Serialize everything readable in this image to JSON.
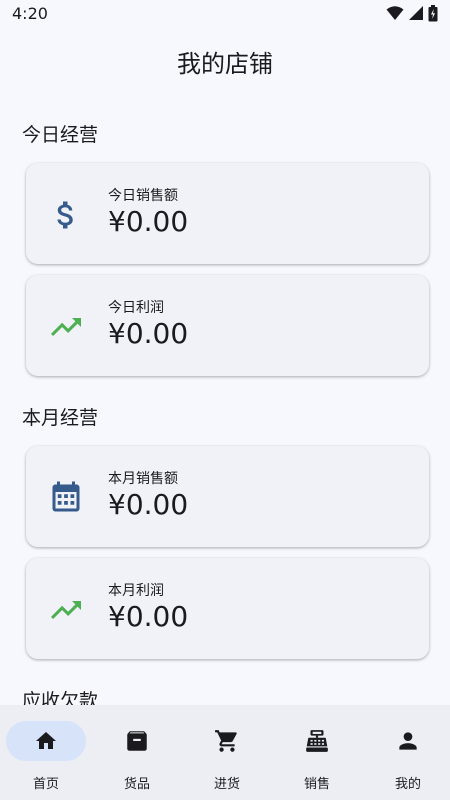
{
  "status_bar": {
    "time": "4:20"
  },
  "page": {
    "title": "我的店铺"
  },
  "sections": {
    "today": "今日经营",
    "month": "本月经营",
    "receivable": "应收欠款"
  },
  "cards": {
    "today_sales": {
      "label": "今日销售额",
      "value": "¥0.00",
      "icon": "dollar-icon"
    },
    "today_profit": {
      "label": "今日利润",
      "value": "¥0.00",
      "icon": "trending-up-icon"
    },
    "month_sales": {
      "label": "本月销售额",
      "value": "¥0.00",
      "icon": "calendar-icon"
    },
    "month_profit": {
      "label": "本月利润",
      "value": "¥0.00",
      "icon": "trending-up-icon"
    }
  },
  "bottom_nav": {
    "items": [
      {
        "label": "首页",
        "icon": "home-icon",
        "active": true
      },
      {
        "label": "货品",
        "icon": "archive-icon"
      },
      {
        "label": "进货",
        "icon": "cart-icon"
      },
      {
        "label": "销售",
        "icon": "cash-register-icon"
      },
      {
        "label": "我的",
        "icon": "person-icon"
      }
    ]
  },
  "colors": {
    "background": "#f7f8fd",
    "card": "#f1f2f7",
    "icon_blue": "#345b8c",
    "icon_green": "#4caf50",
    "nav_active": "#d6e3f8"
  }
}
